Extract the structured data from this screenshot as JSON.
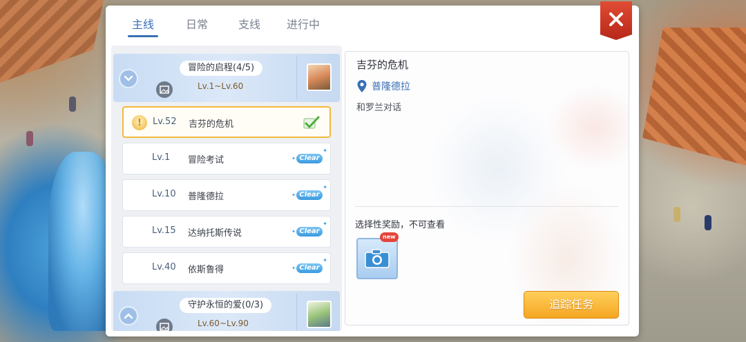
{
  "tabs": [
    {
      "label": "主线",
      "active": true
    },
    {
      "label": "日常",
      "active": false
    },
    {
      "label": "支线",
      "active": false
    },
    {
      "label": "进行中",
      "active": false
    }
  ],
  "close_icon": "close-x",
  "chapters": [
    {
      "title": "冒险的启程(4/5)",
      "level_range": "Lv.1~Lv.60",
      "expanded": true
    },
    {
      "title": "守护永恒的爱(0/3)",
      "level_range": "Lv.60~Lv.90",
      "expanded": false
    }
  ],
  "quests": [
    {
      "level": "Lv.52",
      "name": "吉芬的危机",
      "status": "in-progress",
      "selected": true
    },
    {
      "level": "Lv.1",
      "name": "冒险考试",
      "status": "Clear",
      "selected": false
    },
    {
      "level": "Lv.10",
      "name": "普隆德拉",
      "status": "Clear",
      "selected": false
    },
    {
      "level": "Lv.15",
      "name": "达纳托斯传说",
      "status": "Clear",
      "selected": false
    },
    {
      "level": "Lv.40",
      "name": "依斯鲁得",
      "status": "Clear",
      "selected": false
    }
  ],
  "detail": {
    "title": "吉芬的危机",
    "location": "普隆德拉",
    "objective": "和罗兰对话",
    "reward_label": "选择性奖励，不可查看",
    "reward_badge": "new",
    "reward_icon": "camera-icon"
  },
  "track_button": "追踪任务",
  "colors": {
    "accent": "#3a6fb6",
    "close": "#c8321f",
    "track": "#f5a623",
    "clear_badge": "#3a9ae0"
  }
}
